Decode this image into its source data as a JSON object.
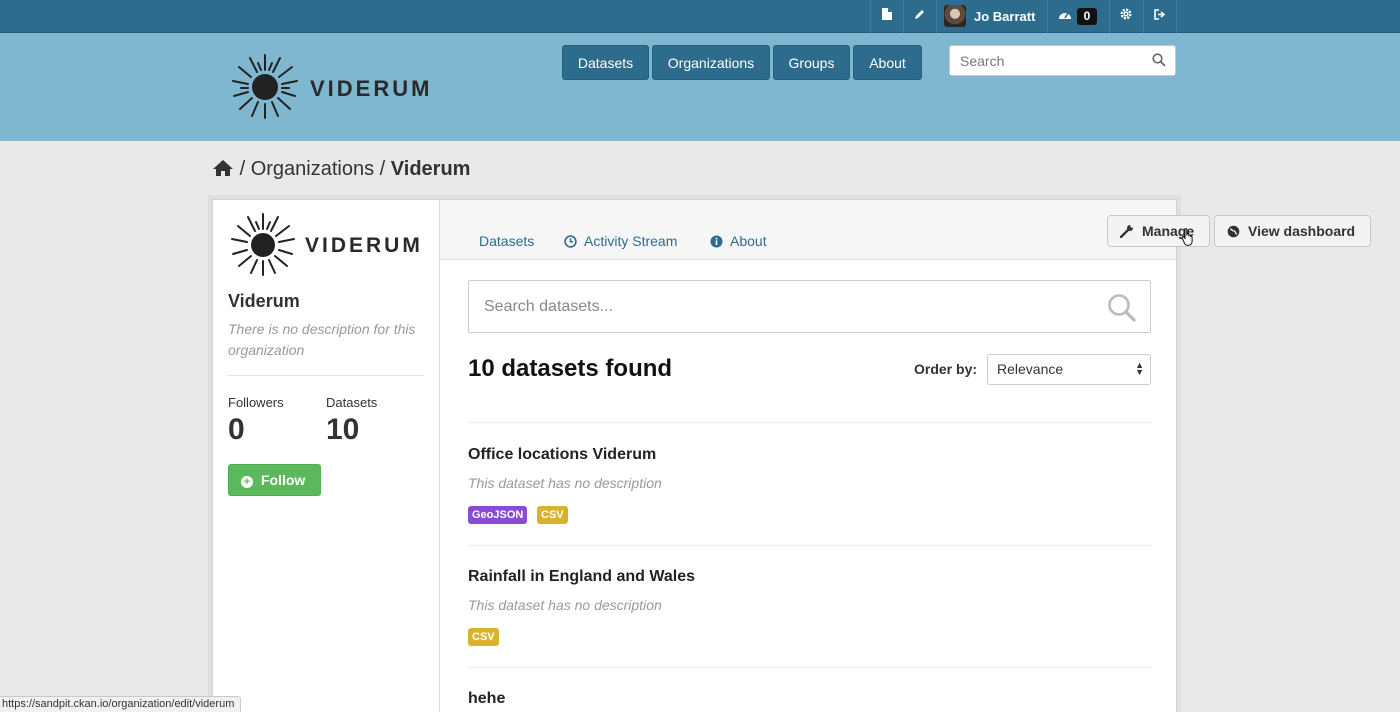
{
  "account": {
    "user_name": "Jo Barratt",
    "dashboard_count": "0",
    "icons": [
      "document-icon",
      "pencil-icon",
      "dashboard-icon",
      "gear-icon",
      "sign-out-icon"
    ]
  },
  "site": {
    "logo_text": "VIDERUM",
    "nav": [
      "Datasets",
      "Organizations",
      "Groups",
      "About"
    ],
    "search_placeholder": "Search"
  },
  "breadcrumb": {
    "separator": "/",
    "organizations": "Organizations",
    "current": "Viderum"
  },
  "organization": {
    "logo_text": "VIDERUM",
    "name": "Viderum",
    "description": "There is no description for this organization",
    "followers_label": "Followers",
    "followers_value": "0",
    "datasets_label": "Datasets",
    "datasets_value": "10",
    "follow_label": "Follow"
  },
  "tabs": {
    "datasets": "Datasets",
    "activity": "Activity Stream",
    "about": "About"
  },
  "actions": {
    "manage": "Manage",
    "view_dashboard": "View dashboard"
  },
  "search": {
    "placeholder": "Search datasets...",
    "results": "10 datasets found",
    "order_label": "Order by:",
    "order_value": "Relevance"
  },
  "datasets": [
    {
      "title": "Office locations Viderum",
      "notes": "This dataset has no description",
      "formats": [
        {
          "label": "GeoJSON",
          "color": "#8a4cd6"
        },
        {
          "label": "CSV",
          "color": "#d9b32e"
        }
      ]
    },
    {
      "title": "Rainfall in England and Wales",
      "notes": "This dataset has no description",
      "formats": [
        {
          "label": "CSV",
          "color": "#d9b32e"
        }
      ]
    },
    {
      "title": "hehe"
    }
  ],
  "status_url": "https://sandpit.ckan.io/organization/edit/viderum",
  "colors": {
    "masthead": "#7fb7d0",
    "account_bar": "#2e6c8e",
    "nav_button": "#2e6c8e",
    "follow_button": "#5cb85c",
    "link": "#2e6c8e"
  }
}
